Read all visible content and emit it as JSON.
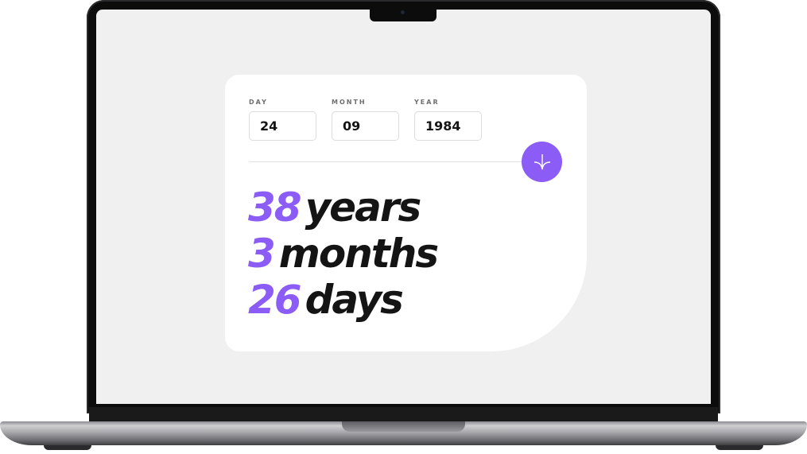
{
  "form": {
    "day": {
      "label": "DAY",
      "value": "24"
    },
    "month": {
      "label": "MONTH",
      "value": "09"
    },
    "year": {
      "label": "YEAR",
      "value": "1984"
    }
  },
  "submit": {
    "icon": "arrow-down-icon"
  },
  "results": {
    "years": {
      "value": "38",
      "unit": "years"
    },
    "months": {
      "value": "3",
      "unit": "months"
    },
    "days": {
      "value": "26",
      "unit": "days"
    }
  },
  "colors": {
    "accent": "#8b5cf6",
    "text": "#141414",
    "screen_bg": "#f0f0f0",
    "card_bg": "#ffffff"
  }
}
